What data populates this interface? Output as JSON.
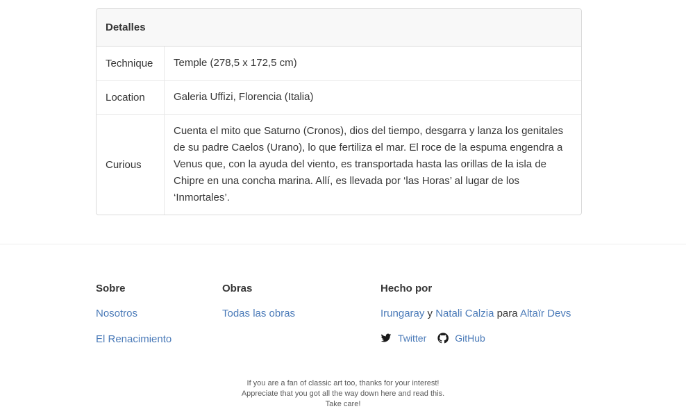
{
  "details": {
    "header": "Detalles",
    "rows": [
      {
        "label": "Technique",
        "value": "Temple (278,5 x 172,5 cm)"
      },
      {
        "label": "Location",
        "value": "Galeria Uffizi, Florencia (Italia)"
      },
      {
        "label": "Curious",
        "value": "Cuenta el mito que Saturno (Cronos), dios del tiempo, desgarra y lanza los genitales de su padre Caelos (Urano), lo que fertiliza el mar. El roce de la espuma engendra a Venus que, con la ayuda del viento, es transportada hasta las orillas de la isla de Chipre en una concha marina. Allí, es llevada por ‘las Horas’ al lugar de los ‘Inmortales’."
      }
    ]
  },
  "footer": {
    "sobre": {
      "title": "Sobre",
      "links": [
        "Nosotros",
        "El Renacimiento"
      ]
    },
    "obras": {
      "title": "Obras",
      "links": [
        "Todas las obras"
      ]
    },
    "hecho_por": {
      "title": "Hecho por",
      "author1": "Irungaray",
      "conj": "y",
      "author2": "Natali Calzia",
      "para": "para",
      "org": "Altaïr Devs",
      "twitter_label": "Twitter",
      "github_label": "GitHub"
    },
    "note": {
      "line1": "If you are a fan of classic art too, thanks for your interest!",
      "line2": "Appreciate that you got all the way down here and read this.",
      "line3": "Take care!"
    }
  },
  "icons": {
    "twitter": "twitter-icon",
    "github": "github-icon"
  },
  "colors": {
    "link": "#4a7ab8",
    "text": "#363636",
    "border": "#dbdbdb",
    "header_bg": "#f8f8f8"
  }
}
